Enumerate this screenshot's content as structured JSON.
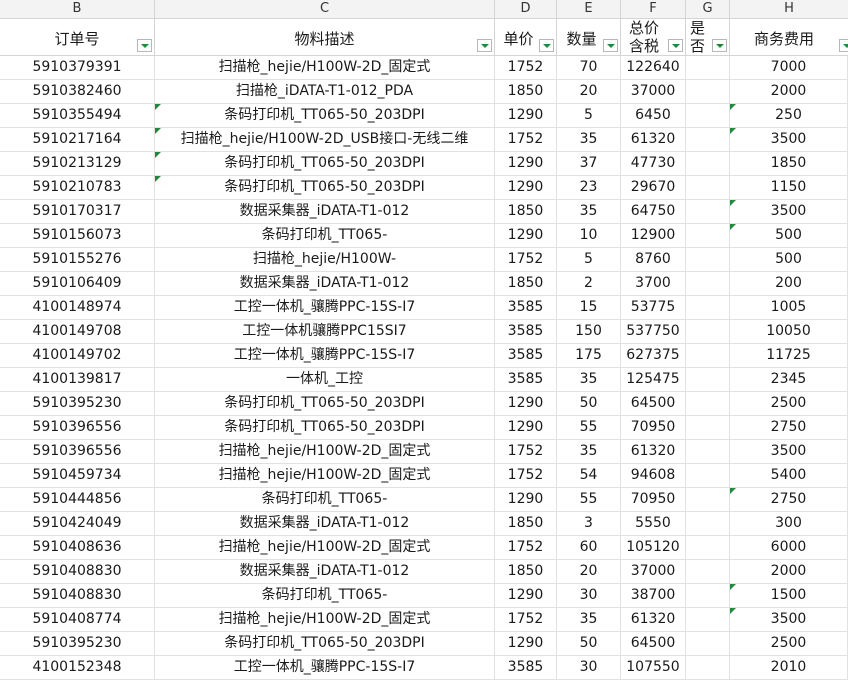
{
  "columns": [
    "B",
    "C",
    "D",
    "E",
    "F",
    "G",
    "H"
  ],
  "headers": [
    "订单号",
    "物料描述",
    "单价",
    "数量",
    "总价含税",
    "是否开票",
    "商务费用"
  ],
  "rows": [
    {
      "order": "5910379391",
      "desc": "扫描枪_hejie/H100W-2D_固定式",
      "price": "1752",
      "qty": "70",
      "total": "122640",
      "invoice": "",
      "fee": "7000",
      "mark_c": false,
      "mark_h": false
    },
    {
      "order": "5910382460",
      "desc": "扫描枪_iDATA-T1-012_PDA",
      "price": "1850",
      "qty": "20",
      "total": "37000",
      "invoice": "",
      "fee": "2000",
      "mark_c": false,
      "mark_h": false
    },
    {
      "order": "5910355494",
      "desc": "条码打印机_TT065-50_203DPI",
      "price": "1290",
      "qty": "5",
      "total": "6450",
      "invoice": "",
      "fee": "250",
      "mark_c": true,
      "mark_h": true
    },
    {
      "order": "5910217164",
      "desc": "扫描枪_hejie/H100W-2D_USB接口-无线二维",
      "price": "1752",
      "qty": "35",
      "total": "61320",
      "invoice": "",
      "fee": "3500",
      "mark_c": true,
      "mark_h": true
    },
    {
      "order": "5910213129",
      "desc": "条码打印机_TT065-50_203DPI",
      "price": "1290",
      "qty": "37",
      "total": "47730",
      "invoice": "",
      "fee": "1850",
      "mark_c": true,
      "mark_h": false
    },
    {
      "order": "5910210783",
      "desc": "条码打印机_TT065-50_203DPI",
      "price": "1290",
      "qty": "23",
      "total": "29670",
      "invoice": "",
      "fee": "1150",
      "mark_c": true,
      "mark_h": false
    },
    {
      "order": "5910170317",
      "desc": "数据采集器_iDATA-T1-012",
      "price": "1850",
      "qty": "35",
      "total": "64750",
      "invoice": "",
      "fee": "3500",
      "mark_c": false,
      "mark_h": true
    },
    {
      "order": "5910156073",
      "desc": "条码打印机_TT065-",
      "price": "1290",
      "qty": "10",
      "total": "12900",
      "invoice": "",
      "fee": "500",
      "mark_c": false,
      "mark_h": true
    },
    {
      "order": "5910155276",
      "desc": "扫描枪_hejie/H100W-",
      "price": "1752",
      "qty": "5",
      "total": "8760",
      "invoice": "",
      "fee": "500",
      "mark_c": false,
      "mark_h": false
    },
    {
      "order": "5910106409",
      "desc": "数据采集器_iDATA-T1-012",
      "price": "1850",
      "qty": "2",
      "total": "3700",
      "invoice": "",
      "fee": "200",
      "mark_c": false,
      "mark_h": false
    },
    {
      "order": "4100148974",
      "desc": "工控一体机_骧腾PPC-15S-I7",
      "price": "3585",
      "qty": "15",
      "total": "53775",
      "invoice": "",
      "fee": "1005",
      "mark_c": false,
      "mark_h": false
    },
    {
      "order": "4100149708",
      "desc": "工控一体机骧腾PPC15SI7",
      "price": "3585",
      "qty": "150",
      "total": "537750",
      "invoice": "",
      "fee": "10050",
      "mark_c": false,
      "mark_h": false
    },
    {
      "order": "4100149702",
      "desc": "工控一体机_骧腾PPC-15S-I7",
      "price": "3585",
      "qty": "175",
      "total": "627375",
      "invoice": "",
      "fee": "11725",
      "mark_c": false,
      "mark_h": false
    },
    {
      "order": "4100139817",
      "desc": "一体机_工控",
      "price": "3585",
      "qty": "35",
      "total": "125475",
      "invoice": "",
      "fee": "2345",
      "mark_c": false,
      "mark_h": false
    },
    {
      "order": "5910395230",
      "desc": "条码打印机_TT065-50_203DPI",
      "price": "1290",
      "qty": "50",
      "total": "64500",
      "invoice": "",
      "fee": "2500",
      "mark_c": false,
      "mark_h": false
    },
    {
      "order": "5910396556",
      "desc": "条码打印机_TT065-50_203DPI",
      "price": "1290",
      "qty": "55",
      "total": "70950",
      "invoice": "",
      "fee": "2750",
      "mark_c": false,
      "mark_h": false
    },
    {
      "order": "5910396556",
      "desc": "扫描枪_hejie/H100W-2D_固定式",
      "price": "1752",
      "qty": "35",
      "total": "61320",
      "invoice": "",
      "fee": "3500",
      "mark_c": false,
      "mark_h": false
    },
    {
      "order": "5910459734",
      "desc": "扫描枪_hejie/H100W-2D_固定式",
      "price": "1752",
      "qty": "54",
      "total": "94608",
      "invoice": "",
      "fee": "5400",
      "mark_c": false,
      "mark_h": false
    },
    {
      "order": "5910444856",
      "desc": "条码打印机_TT065-",
      "price": "1290",
      "qty": "55",
      "total": "70950",
      "invoice": "",
      "fee": "2750",
      "mark_c": false,
      "mark_h": true
    },
    {
      "order": "5910424049",
      "desc": "数据采集器_iDATA-T1-012",
      "price": "1850",
      "qty": "3",
      "total": "5550",
      "invoice": "",
      "fee": "300",
      "mark_c": false,
      "mark_h": false
    },
    {
      "order": "5910408636",
      "desc": "扫描枪_hejie/H100W-2D_固定式",
      "price": "1752",
      "qty": "60",
      "total": "105120",
      "invoice": "",
      "fee": "6000",
      "mark_c": false,
      "mark_h": false
    },
    {
      "order": "5910408830",
      "desc": "数据采集器_iDATA-T1-012",
      "price": "1850",
      "qty": "20",
      "total": "37000",
      "invoice": "",
      "fee": "2000",
      "mark_c": false,
      "mark_h": false
    },
    {
      "order": "5910408830",
      "desc": "条码打印机_TT065-",
      "price": "1290",
      "qty": "30",
      "total": "38700",
      "invoice": "",
      "fee": "1500",
      "mark_c": false,
      "mark_h": true
    },
    {
      "order": "5910408774",
      "desc": "扫描枪_hejie/H100W-2D_固定式",
      "price": "1752",
      "qty": "35",
      "total": "61320",
      "invoice": "",
      "fee": "3500",
      "mark_c": false,
      "mark_h": true
    },
    {
      "order": "5910395230",
      "desc": "条码打印机_TT065-50_203DPI",
      "price": "1290",
      "qty": "50",
      "total": "64500",
      "invoice": "",
      "fee": "2500",
      "mark_c": false,
      "mark_h": false
    },
    {
      "order": "4100152348",
      "desc": "工控一体机_骧腾PPC-15S-I7",
      "price": "3585",
      "qty": "30",
      "total": "107550",
      "invoice": "",
      "fee": "2010",
      "mark_c": false,
      "mark_h": false
    }
  ],
  "colors": {
    "grid": "#e1e1e1",
    "header_bg": "#f3f3f3",
    "comment_marker": "#1f8a3d",
    "filter_arrow": "#1f8a3d"
  }
}
